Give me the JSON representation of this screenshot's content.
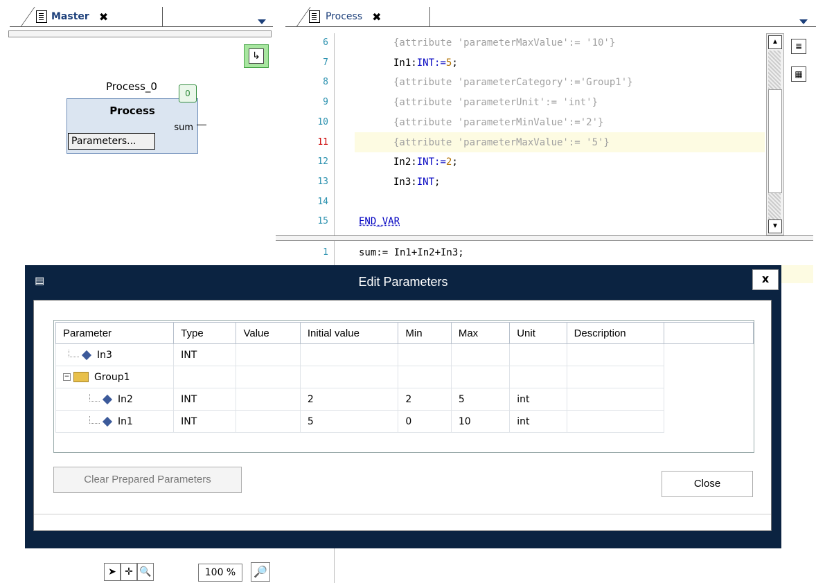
{
  "tabs": {
    "master": {
      "label": "Master",
      "close": "✖"
    },
    "process": {
      "label": "Process",
      "close": "✖"
    }
  },
  "fbd": {
    "instance_name": "Process_0",
    "block_name": "Process",
    "exec_order": "0",
    "output_pin": "sum",
    "params_button": "Parameters..."
  },
  "editor": {
    "lines": [
      {
        "n": "6",
        "text": "{attribute 'parameterMaxValue':= '10'}",
        "kind": "attr"
      },
      {
        "n": "7",
        "text": "In1:INT:=5;",
        "kind": "decl",
        "name": "In1",
        "type": "INT",
        "init": "5"
      },
      {
        "n": "8",
        "text": "{attribute 'parameterCategory':='Group1'}",
        "kind": "attr"
      },
      {
        "n": "9",
        "text": "{attribute 'parameterUnit':= 'int'}",
        "kind": "attr"
      },
      {
        "n": "10",
        "text": "{attribute 'parameterMinValue':='2'}",
        "kind": "attr"
      },
      {
        "n": "11",
        "text": "{attribute 'parameterMaxValue':= '5'}",
        "kind": "attr"
      },
      {
        "n": "12",
        "text": "In2:INT:=2;",
        "kind": "decl",
        "name": "In2",
        "type": "INT",
        "init": "2"
      },
      {
        "n": "13",
        "text": "In3:INT;",
        "kind": "decl",
        "name": "In3",
        "type": "INT"
      },
      {
        "n": "14",
        "text": "",
        "kind": "blank"
      },
      {
        "n": "15",
        "text": "END_VAR",
        "kind": "kw"
      }
    ],
    "body_line": {
      "n": "1",
      "text": "sum:= In1+In2+In3;"
    }
  },
  "toolbar": {
    "zoom": "100 %"
  },
  "dialog": {
    "title": "Edit Parameters",
    "close_x": "x",
    "columns": [
      "Parameter",
      "Type",
      "Value",
      "Initial value",
      "Min",
      "Max",
      "Unit",
      "Description"
    ],
    "rows": [
      {
        "name": "In3",
        "type": "INT",
        "value": "",
        "initial": "",
        "min": "",
        "max": "",
        "unit": "",
        "desc": ""
      },
      {
        "name": "Group1",
        "type": "",
        "value": "",
        "initial": "",
        "min": "",
        "max": "",
        "unit": "",
        "desc": ""
      },
      {
        "name": "In2",
        "type": "INT",
        "value": "",
        "initial": "2",
        "min": "2",
        "max": "5",
        "unit": "int",
        "desc": ""
      },
      {
        "name": "In1",
        "type": "INT",
        "value": "",
        "initial": "5",
        "min": "0",
        "max": "10",
        "unit": "int",
        "desc": ""
      }
    ],
    "clear_button": "Clear Prepared Parameters",
    "close_button": "Close"
  }
}
